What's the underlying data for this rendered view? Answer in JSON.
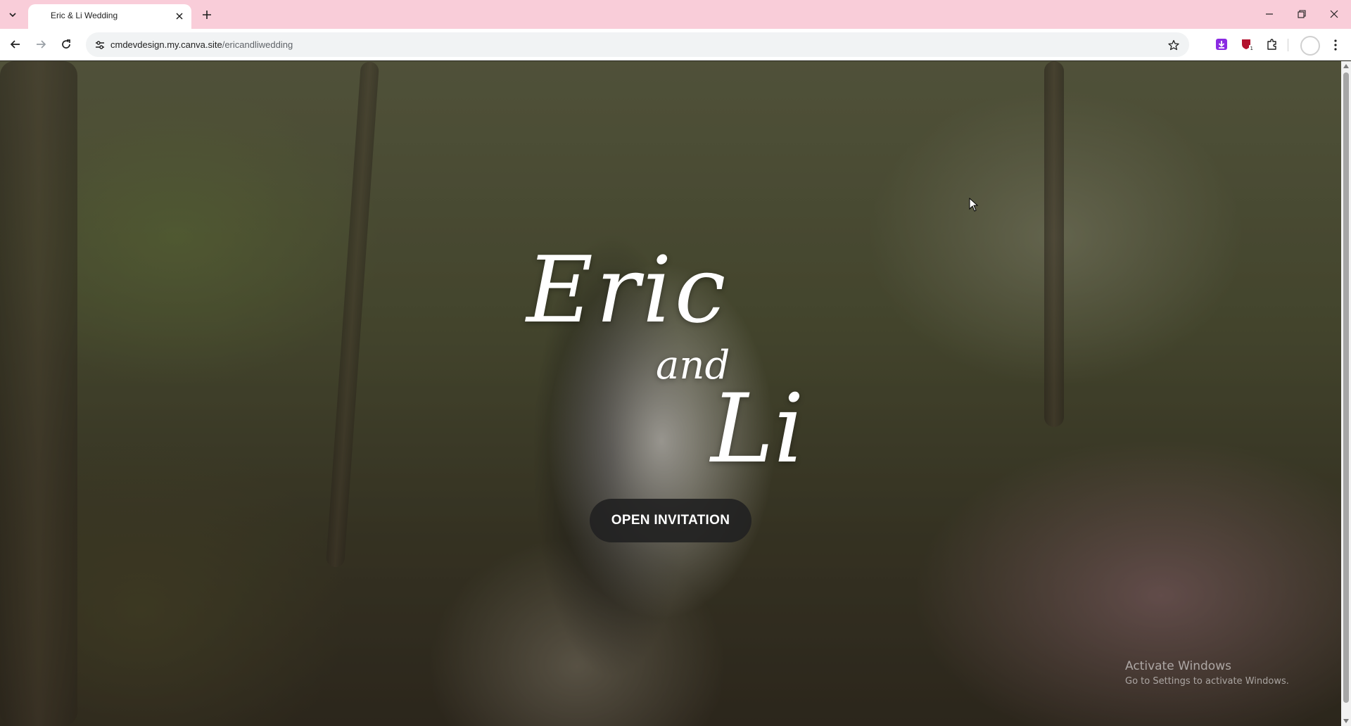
{
  "browser": {
    "tab": {
      "title": "Eric & Li Wedding"
    },
    "address": {
      "domain": "cmdevdesign.my.canva.site",
      "path": "/ericandliwedding"
    },
    "icons": {
      "tab_search": "chevron-down-icon",
      "tab_close": "close-icon",
      "new_tab": "plus-icon",
      "back": "arrow-left-icon",
      "forward": "arrow-right-icon",
      "reload": "reload-icon",
      "site_info": "tune-icon",
      "bookmark": "star-icon",
      "extensions": "puzzle-icon",
      "menu": "kebab-menu-icon"
    },
    "colors": {
      "tabstrip": "#f9cdd9",
      "download_ext": "#8a2be2",
      "shield_ext": "#b3122e"
    },
    "extension_badge": "1"
  },
  "page": {
    "names": {
      "first": "Eric",
      "joiner": "and",
      "second": "Li"
    },
    "open_button": "OPEN INVITATION",
    "button_color": "#222222"
  },
  "os_watermark": {
    "title": "Activate Windows",
    "subtitle": "Go to Settings to activate Windows."
  }
}
